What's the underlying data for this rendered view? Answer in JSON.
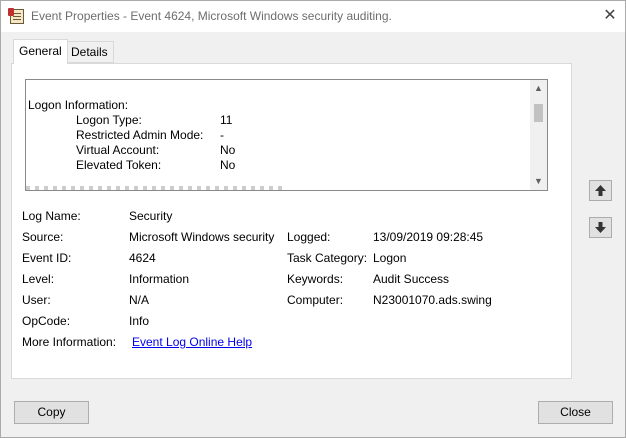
{
  "window": {
    "title": "Event Properties - Event 4624, Microsoft Windows security auditing.",
    "close_glyph": "✕"
  },
  "tabs": [
    {
      "label": "General",
      "active": true
    },
    {
      "label": "Details",
      "active": false
    }
  ],
  "description": {
    "heading": "Logon Information:",
    "rows": [
      {
        "label": "Logon Type:",
        "value": "11"
      },
      {
        "label": "Restricted Admin Mode:",
        "value": "-"
      },
      {
        "label": "Virtual Account:",
        "value": "No"
      },
      {
        "label": "Elevated Token:",
        "value": "No"
      }
    ],
    "scroll_up_glyph": "▲",
    "scroll_down_glyph": "▼"
  },
  "fields": {
    "log_name": {
      "label": "Log Name:",
      "value": "Security"
    },
    "source": {
      "label": "Source:",
      "value": "Microsoft Windows security"
    },
    "logged": {
      "label": "Logged:",
      "value": "13/09/2019 09:28:45"
    },
    "event_id": {
      "label": "Event ID:",
      "value": "4624"
    },
    "task_category": {
      "label": "Task Category:",
      "value": "Logon"
    },
    "level": {
      "label": "Level:",
      "value": "Information"
    },
    "keywords": {
      "label": "Keywords:",
      "value": "Audit Success"
    },
    "user": {
      "label": "User:",
      "value": "N/A"
    },
    "computer": {
      "label": "Computer:",
      "value": "N23001070.ads.swing"
    },
    "opcode": {
      "label": "OpCode:",
      "value": "Info"
    },
    "more_info": {
      "label": "More Information:",
      "link": "Event Log Online Help"
    }
  },
  "buttons": {
    "copy": "Copy",
    "close": "Close"
  },
  "icons": {
    "title": "event-viewer-icon",
    "previous": "arrow-up-icon",
    "next": "arrow-down-icon"
  }
}
